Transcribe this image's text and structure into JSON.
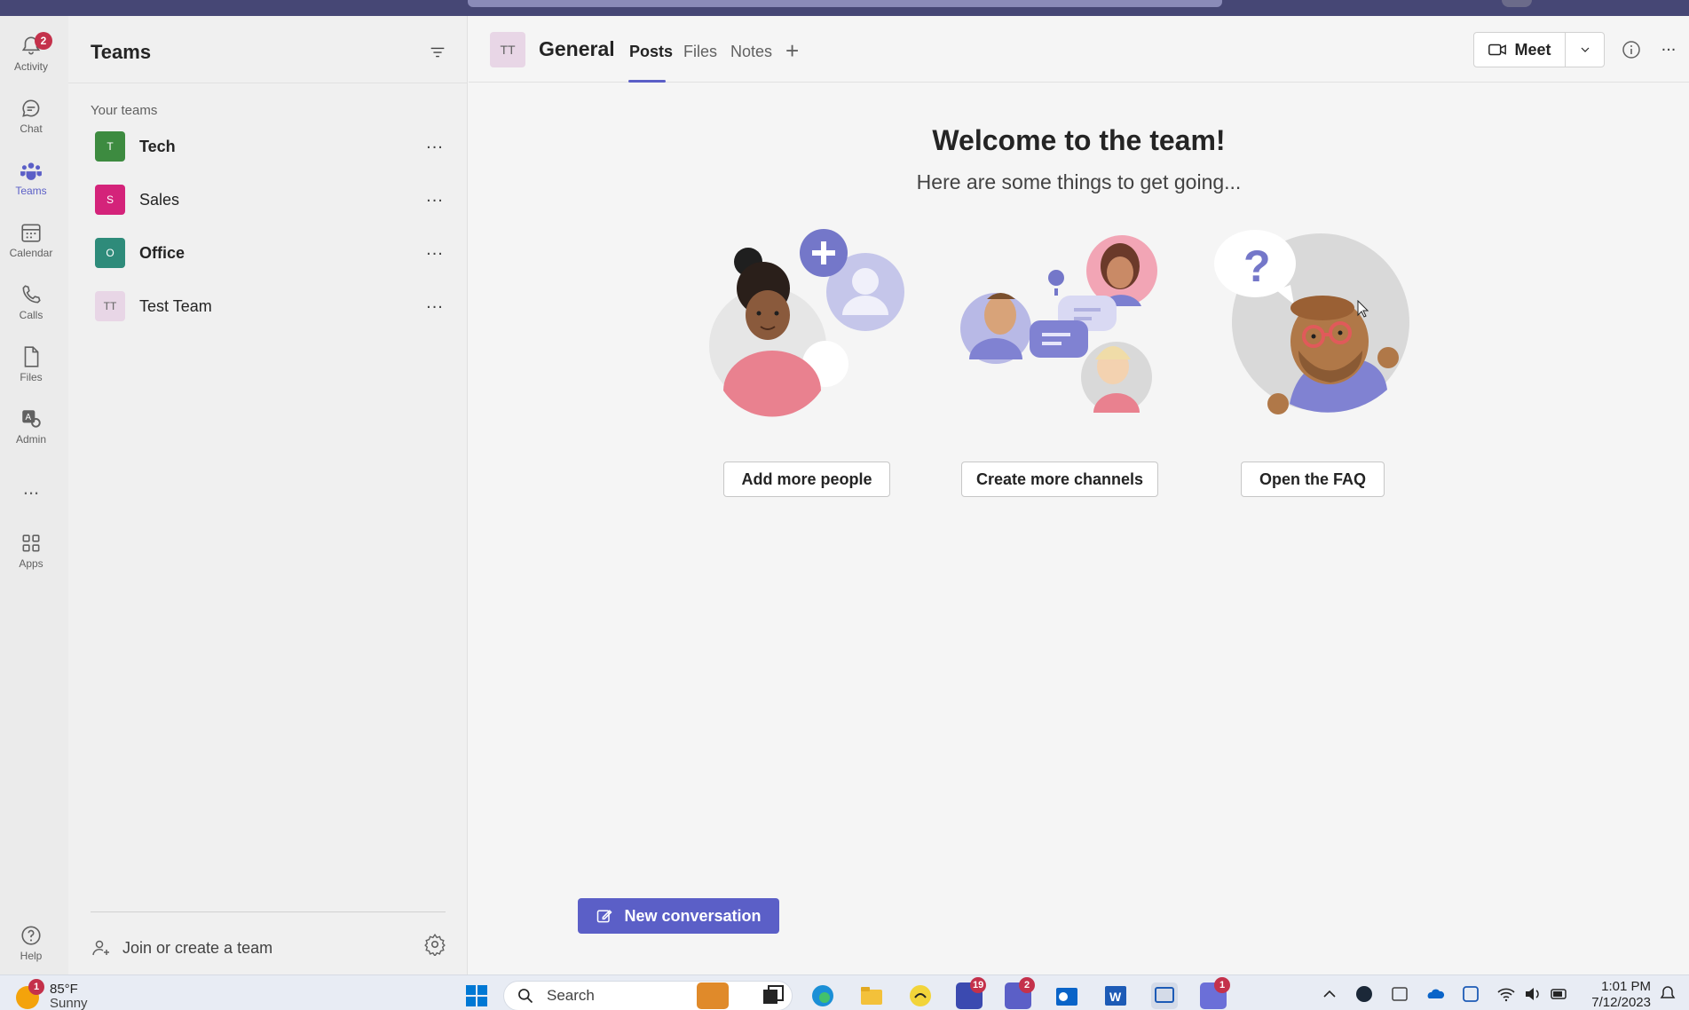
{
  "rail": {
    "items": [
      {
        "label": "Activity",
        "badge": "2"
      },
      {
        "label": "Chat"
      },
      {
        "label": "Teams"
      },
      {
        "label": "Calendar"
      },
      {
        "label": "Calls"
      },
      {
        "label": "Files"
      },
      {
        "label": "Admin"
      },
      {
        "label": "Apps"
      },
      {
        "label": "Help"
      }
    ],
    "more": "..."
  },
  "panel": {
    "title": "Teams",
    "section_label": "Your teams",
    "teams": [
      {
        "initials": "T",
        "name": "Tech",
        "color": "#3d8b40"
      },
      {
        "initials": "S",
        "name": "Sales",
        "color": "#d4237a"
      },
      {
        "initials": "O",
        "name": "Office",
        "color": "#2e8b7a"
      },
      {
        "initials": "TT",
        "name": "Test Team",
        "color": "#e8d6e6"
      }
    ],
    "more": "...",
    "join_label": "Join or create a team"
  },
  "header": {
    "channel_initials": "TT",
    "channel_name": "General",
    "tabs": [
      "Posts",
      "Files",
      "Notes"
    ],
    "add_tab": "+",
    "meet_label": "Meet",
    "more": "..."
  },
  "welcome": {
    "title": "Welcome to the team!",
    "subtitle": "Here are some things to get going...",
    "actions": [
      "Add more people",
      "Create more channels",
      "Open the FAQ"
    ]
  },
  "compose": {
    "new_conversation": "New conversation"
  },
  "taskbar": {
    "weather_badge": "1",
    "temperature": "85°F",
    "condition": "Sunny",
    "search_label": "Search",
    "badges": {
      "calendar_app": "19",
      "teams_app": "2",
      "discord_app": "1"
    },
    "time": "1:01 PM",
    "date": "7/12/2023"
  },
  "colors": {
    "accent": "#5b5fc7",
    "badge": "#c4314b",
    "titlebar": "#464775"
  }
}
